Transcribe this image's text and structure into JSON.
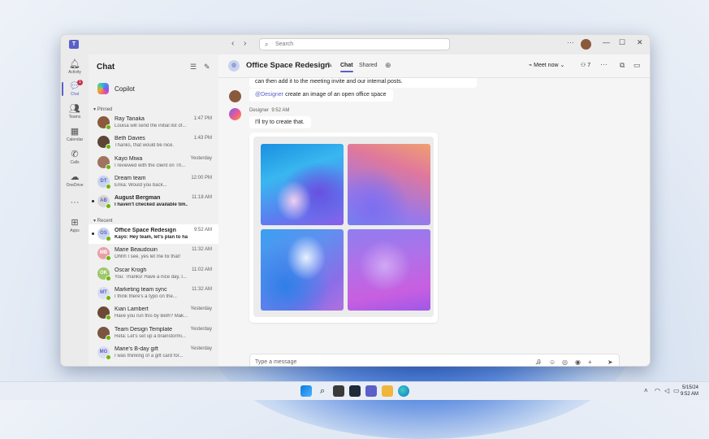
{
  "titlebar": {
    "search_placeholder": "Search",
    "more": "···",
    "minimize": "—",
    "maximize": "☐",
    "close": "✕"
  },
  "rail": {
    "items": [
      {
        "label": "Activity",
        "icon": "bell-icon"
      },
      {
        "label": "Chat",
        "icon": "chat-icon",
        "active": true,
        "badge": "1"
      },
      {
        "label": "Teams",
        "icon": "teams-icon"
      },
      {
        "label": "Calendar",
        "icon": "calendar-icon"
      },
      {
        "label": "Calls",
        "icon": "phone-icon"
      },
      {
        "label": "OneDrive",
        "icon": "cloud-icon"
      },
      {
        "label": "···",
        "icon": "more-icon"
      },
      {
        "label": "Apps",
        "icon": "apps-icon"
      }
    ]
  },
  "chatlist": {
    "title": "Chat",
    "copilot": "Copilot",
    "pinned_label": "Pinned",
    "recent_label": "Recent",
    "pinned": [
      {
        "name": "Ray Tanaka",
        "preview": "Louisa will send the initial list of...",
        "time": "1:47 PM",
        "color": "#8a5a3c",
        "initials": ""
      },
      {
        "name": "Beth Davies",
        "preview": "Thanks, that would be nice.",
        "time": "1:43 PM",
        "color": "#5d4636",
        "initials": ""
      },
      {
        "name": "Kayo Miwa",
        "preview": "I reviewed with the client on Th...",
        "time": "Yesterday",
        "color": "#a07460",
        "initials": ""
      },
      {
        "name": "Dream team",
        "preview": "Erika: Would you back...",
        "time": "12:00 PM",
        "color": "#c9d4ec",
        "initials": "DT"
      },
      {
        "name": "August Bergman",
        "preview": "I haven't checked available tim...",
        "time": "11:18 AM",
        "color": "#d6d6d6",
        "initials": "AB",
        "unread": true
      }
    ],
    "recent": [
      {
        "name": "Office Space Redesign",
        "preview": "Kayo: Hey team, let's plan to ha...",
        "time": "9:52 AM",
        "color": "#c9d4ec",
        "initials": "OS",
        "selected": true,
        "unread": true
      },
      {
        "name": "Marie Beaudouin",
        "preview": "Ohhh I see, yes let me fix that!",
        "time": "11:32 AM",
        "color": "#e8a0a8",
        "initials": "MB"
      },
      {
        "name": "Oscar Krogh",
        "preview": "You: Thanks! Have a nice day, I...",
        "time": "11:02 AM",
        "color": "#9fc86b",
        "initials": "OK"
      },
      {
        "name": "Marketing team sync",
        "preview": "I think there's a typo on the...",
        "time": "11:32 AM",
        "color": "#d9def0",
        "initials": "MT"
      },
      {
        "name": "Kian Lambert",
        "preview": "Have you run this by Beth? Mak...",
        "time": "Yesterday",
        "color": "#6a4a36",
        "initials": ""
      },
      {
        "name": "Team Design Template",
        "preview": "Reta: Let's set up a brainstormi...",
        "time": "Yesterday",
        "color": "#7a5540",
        "initials": ""
      },
      {
        "name": "Marie's B-day gift",
        "preview": "I was thinking of a gift card for...",
        "time": "Yesterday",
        "color": "#d9def0",
        "initials": "MG"
      }
    ]
  },
  "conversation": {
    "title": "Office Space Redesign",
    "tabs": [
      "Chat",
      "Shared"
    ],
    "meet_now": "Meet now",
    "participants": "7",
    "messages": {
      "prev_fragment": "can then add it to the meeting invite and our internal posts.",
      "mention": "@Designer",
      "request": "create an image of an open office space",
      "designer_name": "Designer",
      "designer_time": "9:52 AM",
      "designer_reply": "I'll try to create that."
    },
    "composer_placeholder": "Type a message"
  },
  "taskbar": {
    "date": "5/15/24",
    "time": "9:52 AM"
  }
}
